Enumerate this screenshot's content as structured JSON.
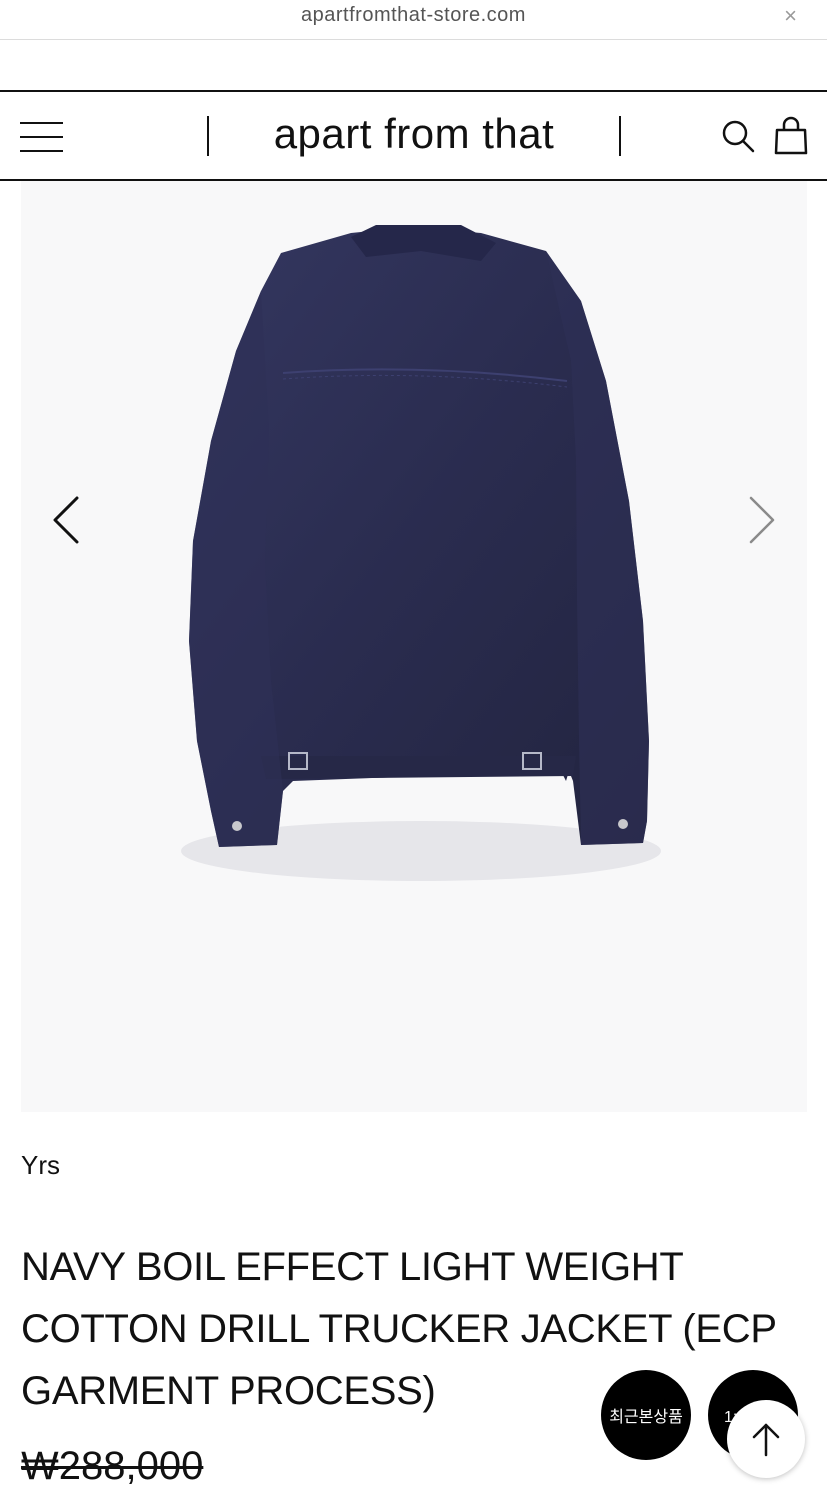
{
  "browser": {
    "url": "apartfromthat-store.com",
    "close_icon": "×"
  },
  "header": {
    "brand": "apart from that",
    "menu_icon": "hamburger-icon",
    "search_icon": "search-icon",
    "cart_icon": "shopping-bag-icon"
  },
  "gallery": {
    "product_image": "navy trucker jacket back view",
    "prev_icon": "chevron-left-icon",
    "next_icon": "chevron-right-icon"
  },
  "product": {
    "brand": "Yrs",
    "title": "NAVY BOIL EFFECT LIGHT WEIGHT COTTON DRILL TRUCKER JACKET (ECP GARMENT PROCESS)",
    "price": "₩288,000"
  },
  "floating": {
    "recent_label": "최근본상품",
    "chat_label": "1:1문의",
    "top_icon": "arrow-up-icon"
  },
  "colors": {
    "jacket": "#2b2d50",
    "background": "#f8f8f9",
    "text": "#111111"
  }
}
